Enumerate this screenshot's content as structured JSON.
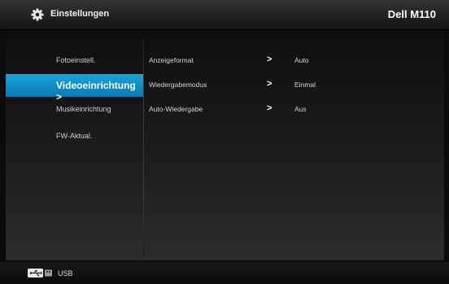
{
  "header": {
    "title": "Einstellungen",
    "device": "Dell M110",
    "icon": "gear-icon"
  },
  "sidebar": {
    "items": [
      {
        "label": "Fotoeinstell.",
        "active": false
      },
      {
        "label": "Videoeinrichtung >",
        "active": true
      },
      {
        "label": "Musikeinrichtung",
        "active": false
      },
      {
        "label": "FW-Aktual.",
        "active": false
      }
    ]
  },
  "settings": [
    {
      "name": "Anzeigeformat",
      "arrow": ">",
      "value": "Auto"
    },
    {
      "name": "Wiedergabemodus",
      "arrow": ">",
      "value": "Einmal"
    },
    {
      "name": "Auto-Wiedergabe",
      "arrow": ">",
      "value": "Aus"
    }
  ],
  "footer": {
    "source_label": "USB",
    "icon": "usb-icon"
  },
  "colors": {
    "accent": "#0f8ccb",
    "background": "#0b0b0b"
  }
}
